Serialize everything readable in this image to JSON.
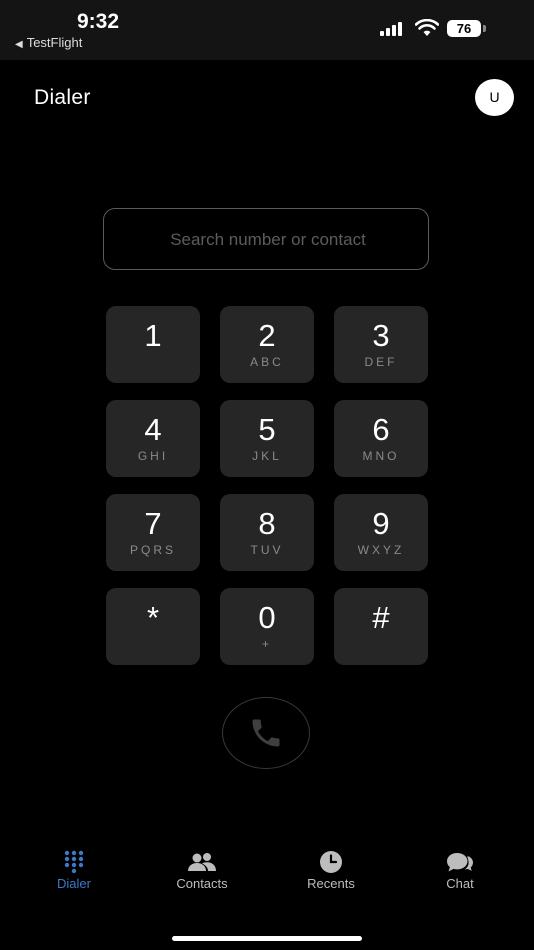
{
  "status_bar": {
    "time": "9:32",
    "back_app": "TestFlight",
    "battery": "76"
  },
  "header": {
    "title": "Dialer",
    "avatar_initial": "U"
  },
  "search": {
    "placeholder": "Search number or contact"
  },
  "keypad": {
    "keys": [
      {
        "digit": "1",
        "letters": ""
      },
      {
        "digit": "2",
        "letters": "ABC"
      },
      {
        "digit": "3",
        "letters": "DEF"
      },
      {
        "digit": "4",
        "letters": "GHI"
      },
      {
        "digit": "5",
        "letters": "JKL"
      },
      {
        "digit": "6",
        "letters": "MNO"
      },
      {
        "digit": "7",
        "letters": "PQRS"
      },
      {
        "digit": "8",
        "letters": "TUV"
      },
      {
        "digit": "9",
        "letters": "WXYZ"
      },
      {
        "digit": "*",
        "letters": ""
      },
      {
        "digit": "0",
        "letters": "+"
      },
      {
        "digit": "#",
        "letters": ""
      }
    ]
  },
  "call_button": {
    "icon": "phone-icon"
  },
  "tabs": [
    {
      "label": "Dialer",
      "icon": "keypad-icon",
      "active": true
    },
    {
      "label": "Contacts",
      "icon": "contacts-icon",
      "active": false
    },
    {
      "label": "Recents",
      "icon": "clock-icon",
      "active": false
    },
    {
      "label": "Chat",
      "icon": "chat-icon",
      "active": false
    }
  ],
  "colors": {
    "background": "#000000",
    "key_background": "#262626",
    "accent": "#3d79c4"
  }
}
